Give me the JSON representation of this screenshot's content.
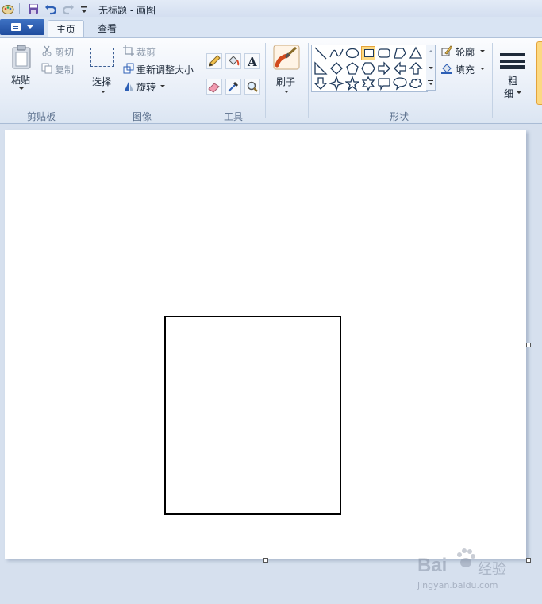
{
  "window": {
    "title": "无标题 - 画图"
  },
  "tabs": [
    {
      "label": "主页"
    },
    {
      "label": "查看"
    }
  ],
  "clipboard": {
    "paste_label": "粘贴",
    "cut_label": "剪切",
    "copy_label": "复制",
    "group_label": "剪贴板"
  },
  "image": {
    "select_label": "选择",
    "crop_label": "裁剪",
    "resize_label": "重新调整大小",
    "rotate_label": "旋转",
    "group_label": "图像"
  },
  "tools": {
    "group_label": "工具"
  },
  "brushes": {
    "label": "刷子"
  },
  "shapes": {
    "outline_label": "轮廓",
    "fill_label": "填充",
    "group_label": "形状"
  },
  "size": {
    "label_line1": "粗",
    "label_line2": "细"
  },
  "watermark": {
    "brand": "Bai",
    "brand_cn": "经验",
    "url": "jingyan.baidu.com"
  },
  "colors": {
    "selected_shape": "#fcd982",
    "ribbon": "#e6edf7",
    "canvas": "#ffffff"
  },
  "selected_shape_tool": "rectangle-shape"
}
